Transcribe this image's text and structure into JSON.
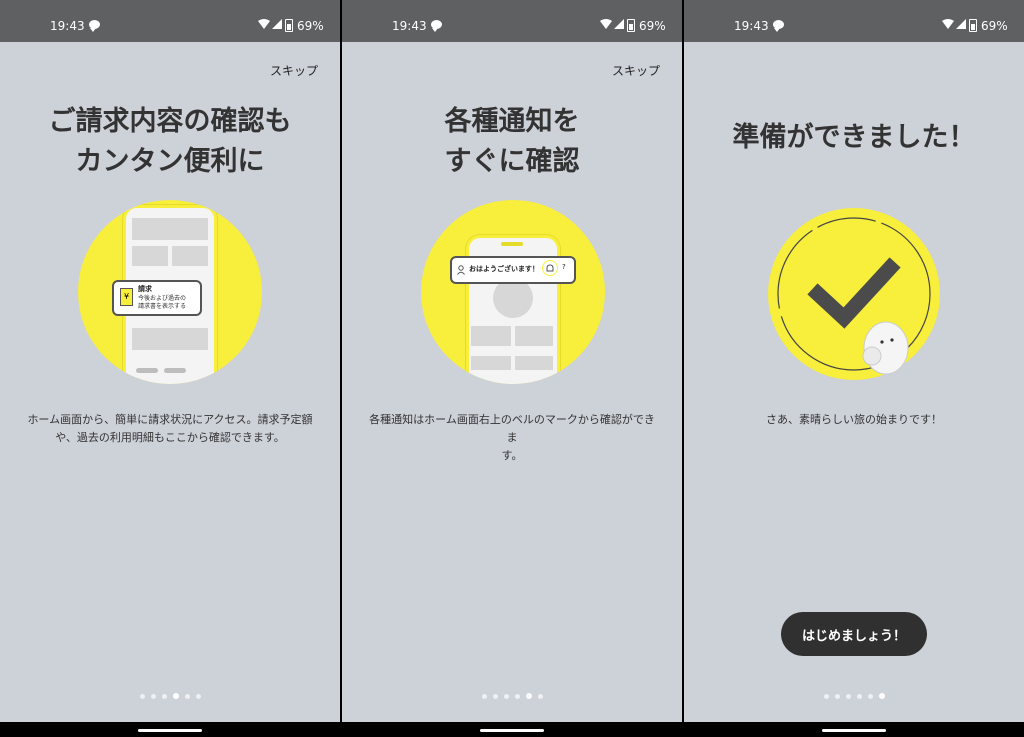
{
  "status_bar": {
    "time": "19:43",
    "battery": "69%",
    "icons": [
      "chat-icon",
      "wifi-icon",
      "signal-icon",
      "battery-icon"
    ]
  },
  "skip_label": "スキップ",
  "colors": {
    "accent_yellow": "#f8ee3c",
    "background": "#cdd1d8",
    "status_bar": "#5f6062",
    "button": "#303030"
  },
  "pages": [
    {
      "title_line1": "ご請求内容の確認も",
      "title_line2": "カンタン便利に",
      "card_title": "請求",
      "card_line1": "今後および過去の",
      "card_line2": "請求書を表示する",
      "description_line1": "ホーム画面から、簡単に請求状況にアクセス。請求予定額",
      "description_line2": "や、過去の利用明細もここから確認できます。",
      "active_dot": 4
    },
    {
      "title_line1": "各種通知を",
      "title_line2": "すぐに確認",
      "greeting": "おはようございます！",
      "help_glyph": "?",
      "description_line1": "各種通知はホーム画面右上のベルのマークから確認ができま",
      "description_line2": "す。",
      "active_dot": 5
    },
    {
      "title": "準備ができました！",
      "description": "さあ、素晴らしい旅の始まりです！",
      "button_label": "はじめましょう！",
      "active_dot": 6
    }
  ],
  "page_count": 6
}
